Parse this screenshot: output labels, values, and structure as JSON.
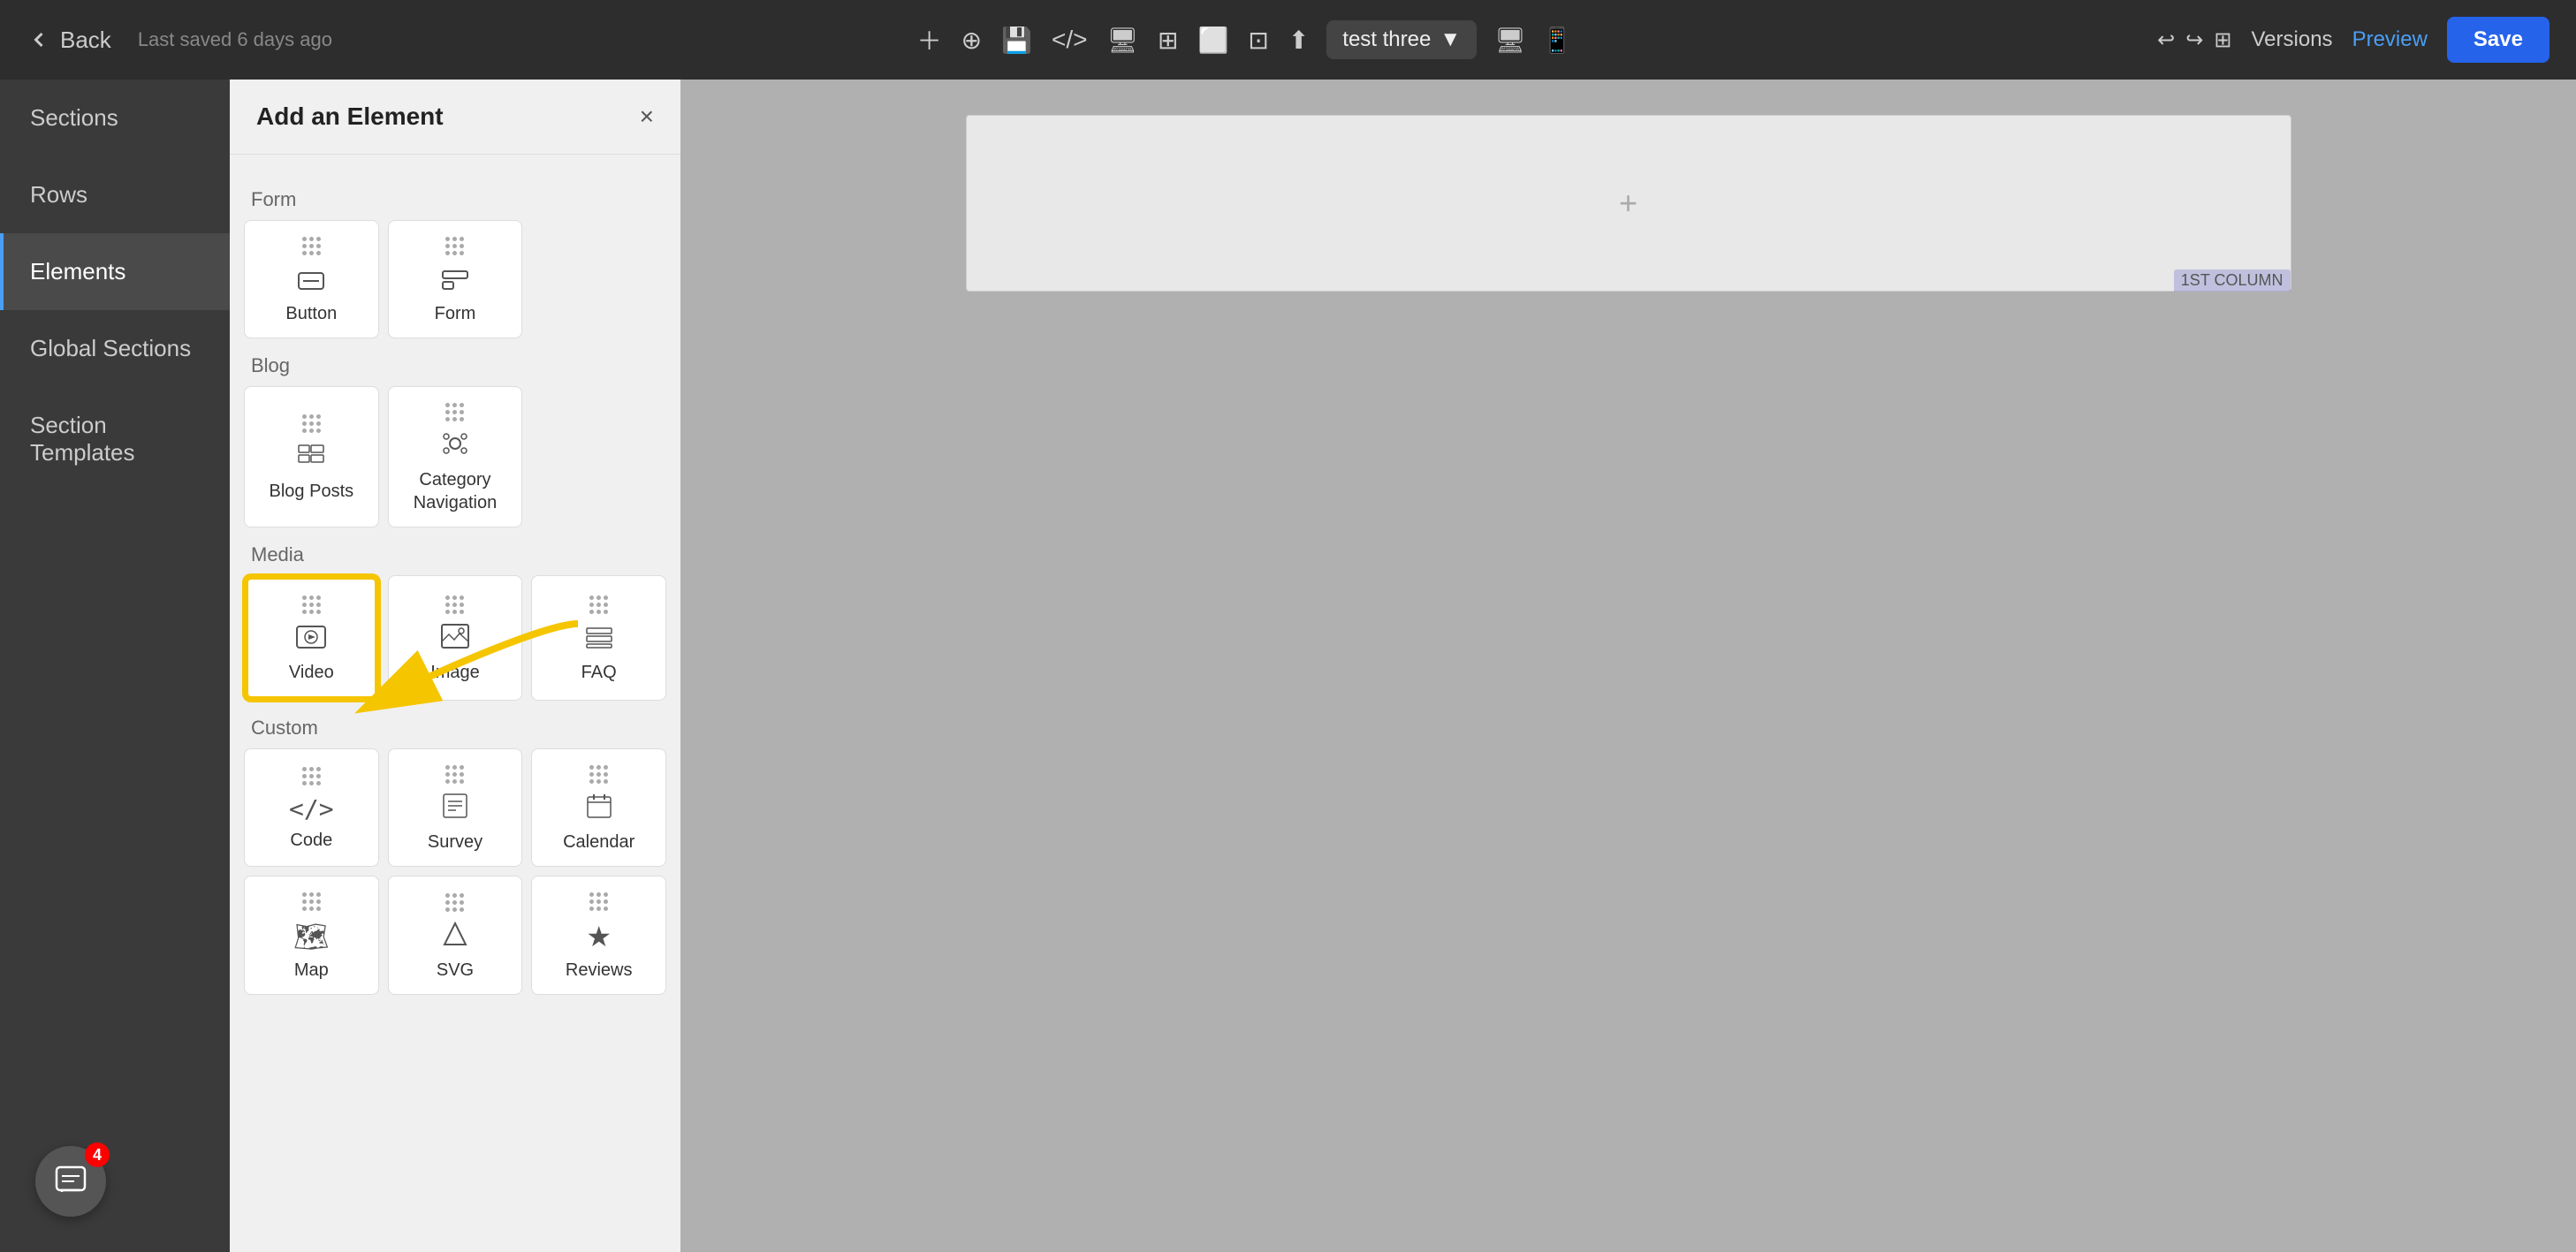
{
  "topbar": {
    "back_label": "Back",
    "last_saved": "Last saved 6 days ago",
    "page_name": "test three",
    "versions_label": "Versions",
    "preview_label": "Preview",
    "save_label": "Save"
  },
  "sidebar": {
    "items": [
      {
        "id": "sections",
        "label": "Sections"
      },
      {
        "id": "rows",
        "label": "Rows"
      },
      {
        "id": "elements",
        "label": "Elements",
        "active": true
      },
      {
        "id": "global-sections",
        "label": "Global Sections"
      },
      {
        "id": "section-templates",
        "label": "Section Templates"
      }
    ]
  },
  "panel": {
    "title": "Add an Element",
    "close_label": "×",
    "sections": [
      {
        "label": "Form",
        "items": [
          {
            "id": "button",
            "label": "Button",
            "icon": "⬛"
          },
          {
            "id": "form",
            "label": "Form",
            "icon": "⬚"
          }
        ]
      },
      {
        "label": "Blog",
        "items": [
          {
            "id": "blog-posts",
            "label": "Blog Posts",
            "icon": "☰"
          },
          {
            "id": "category-navigation",
            "label": "Category Navigation",
            "icon": "✦"
          }
        ]
      },
      {
        "label": "Media",
        "items": [
          {
            "id": "video",
            "label": "Video",
            "icon": "▶",
            "highlighted": true,
            "yellow_border": true
          },
          {
            "id": "image",
            "label": "Image",
            "icon": "🖼"
          },
          {
            "id": "faq",
            "label": "FAQ",
            "icon": "☰"
          }
        ]
      },
      {
        "label": "Custom",
        "items": [
          {
            "id": "code",
            "label": "Code",
            "icon": "</>"
          },
          {
            "id": "survey",
            "label": "Survey",
            "icon": "📋"
          },
          {
            "id": "calendar",
            "label": "Calendar",
            "icon": "📅"
          }
        ]
      },
      {
        "label": "",
        "items": [
          {
            "id": "map",
            "label": "Map",
            "icon": "🗺"
          },
          {
            "id": "svg",
            "label": "SVG",
            "icon": "△"
          },
          {
            "id": "reviews",
            "label": "Reviews",
            "icon": "★"
          }
        ]
      }
    ]
  },
  "canvas": {
    "col_badge": "1ST COLUMN",
    "plus_symbol": "+"
  },
  "chat": {
    "badge_count": "4"
  }
}
